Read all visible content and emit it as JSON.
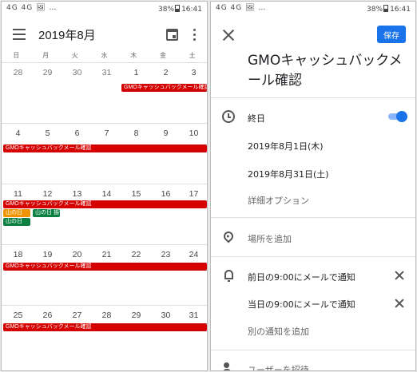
{
  "status_bar": {
    "left": "4G 4G 🖼 …",
    "battery": "38%",
    "time": "16:41"
  },
  "calendar": {
    "month_title": "2019年8月",
    "weekdays": [
      "日",
      "月",
      "火",
      "水",
      "木",
      "金",
      "土"
    ],
    "weeks": [
      [
        "28",
        "29",
        "30",
        "31",
        "1",
        "2",
        "3"
      ],
      [
        "4",
        "5",
        "6",
        "7",
        "8",
        "9",
        "10"
      ],
      [
        "11",
        "12",
        "13",
        "14",
        "15",
        "16",
        "17"
      ],
      [
        "18",
        "19",
        "20",
        "21",
        "22",
        "23",
        "24"
      ],
      [
        "25",
        "26",
        "27",
        "28",
        "29",
        "30",
        "31"
      ]
    ],
    "event_name": "GMOキャッシュバックメール確認",
    "holiday_1": "山の日",
    "holiday_2": "山の日 振替",
    "holiday_3": "山の日",
    "colors": {
      "event": "#d50000",
      "holiday_orange": "#f09300",
      "holiday_green": "#0b8043"
    }
  },
  "editor": {
    "save_label": "保存",
    "title": "GMOキャッシュバックメール確認",
    "all_day_label": "終日",
    "all_day_on": true,
    "start_date": "2019年8月1日(木)",
    "end_date": "2019年8月31日(土)",
    "more_options": "詳細オプション",
    "add_location": "場所を追加",
    "notification_1": "前日の9:00にメールで通知",
    "notification_2": "当日の9:00にメールで通知",
    "add_notification": "別の通知を追加",
    "invite_users": "ユーザーを招待",
    "accent_color": "#1a73e8"
  }
}
